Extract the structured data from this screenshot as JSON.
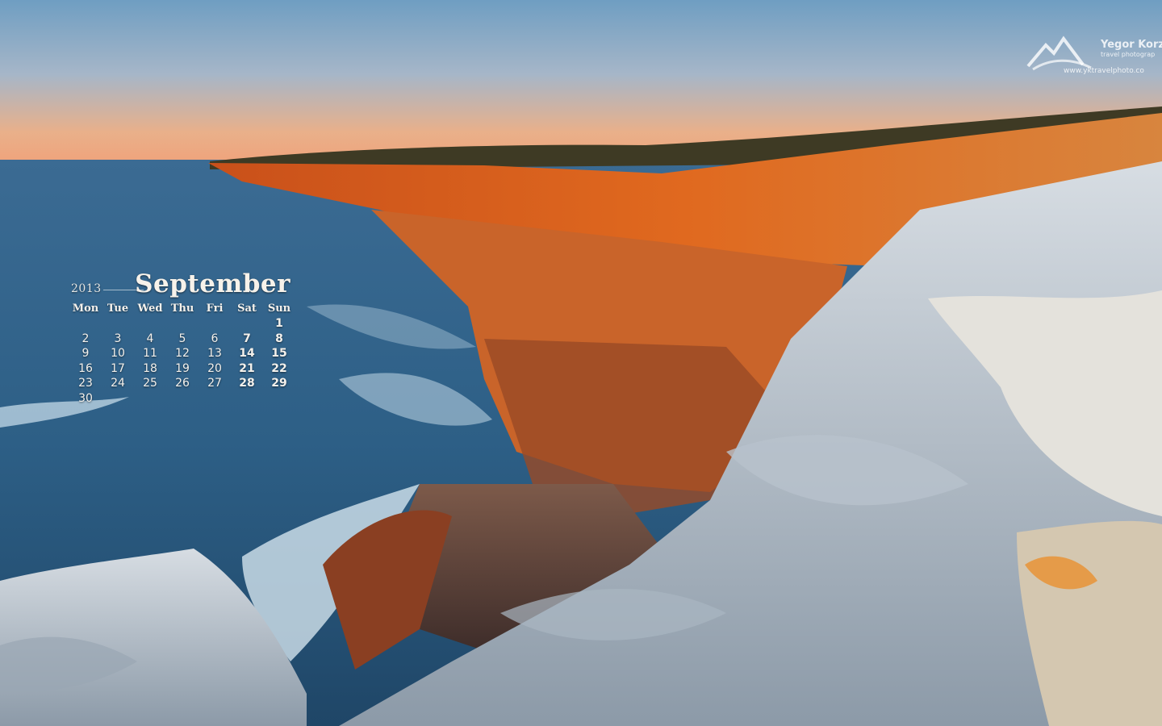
{
  "calendar": {
    "year": "2013",
    "month": "September",
    "weekdays": [
      "Mon",
      "Tue",
      "Wed",
      "Thu",
      "Fri",
      "Sat",
      "Sun"
    ],
    "first_weekday_index": 6,
    "days_in_month": 30
  },
  "watermark": {
    "name": "Yegor Korz",
    "tagline": "travel photograp",
    "url": "www.yktravelphoto.co"
  },
  "colors": {
    "sky_top": "#6f9ec2",
    "sky_horizon": "#f0a27a",
    "sea": "#2d5f86",
    "cliff_glow": "#e0691f",
    "rock_light": "#c9d3dc"
  }
}
